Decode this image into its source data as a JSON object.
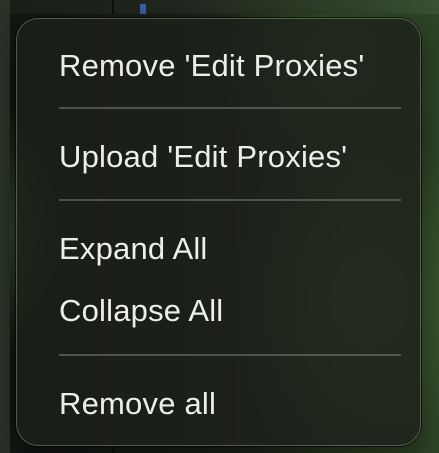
{
  "menu": {
    "items": [
      {
        "label": "Remove 'Edit Proxies'"
      },
      {
        "label": "Upload 'Edit Proxies'"
      },
      {
        "label": "Expand All"
      },
      {
        "label": "Collapse All"
      },
      {
        "label": "Remove all"
      }
    ]
  },
  "colors": {
    "menu_background": "#1c201a",
    "text": "#ebeeea",
    "separator": "#787f74",
    "backdrop_accent": "#4c7034"
  }
}
